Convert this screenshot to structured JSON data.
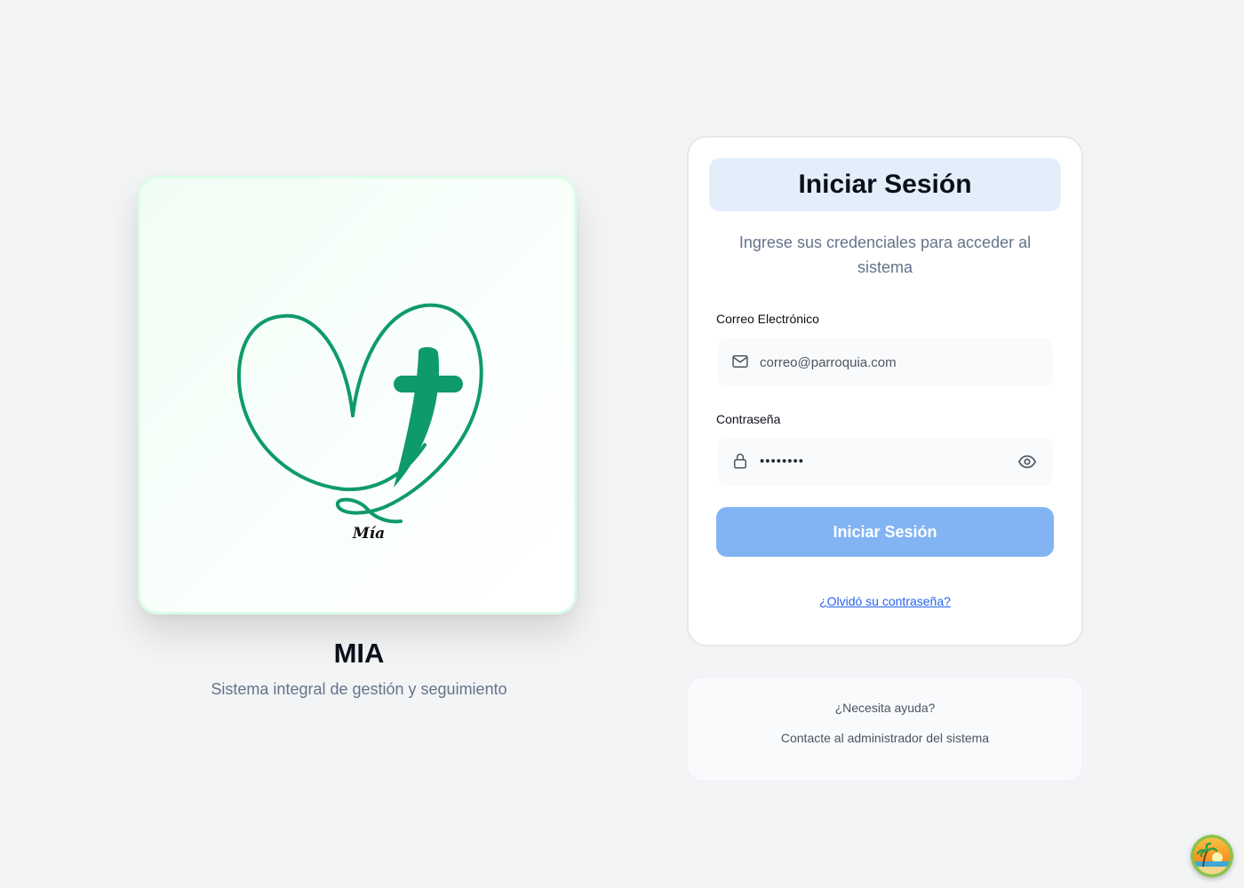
{
  "brand": {
    "logo_caption": "Mía",
    "title": "MIA",
    "subtitle": "Sistema integral de gestión y seguimiento",
    "accent_color": "#0f9a6c"
  },
  "login": {
    "heading": "Iniciar Sesión",
    "description": "Ingrese sus credenciales para acceder al sistema",
    "email": {
      "label": "Correo Electrónico",
      "placeholder": "correo@parroquia.com",
      "icon": "mail-icon"
    },
    "password": {
      "label": "Contraseña",
      "value_masked": "••••••••",
      "icon": "lock-icon",
      "toggle_icon": "eye-icon"
    },
    "submit_label": "Iniciar Sesión",
    "submit_color": "#82b4f4",
    "forgot_label": "¿Olvidó su contraseña?"
  },
  "help": {
    "title": "¿Necesita ayuda?",
    "text": "Contacte al administrador del sistema"
  },
  "corner_widget": {
    "icon": "beach-avatar-icon"
  }
}
